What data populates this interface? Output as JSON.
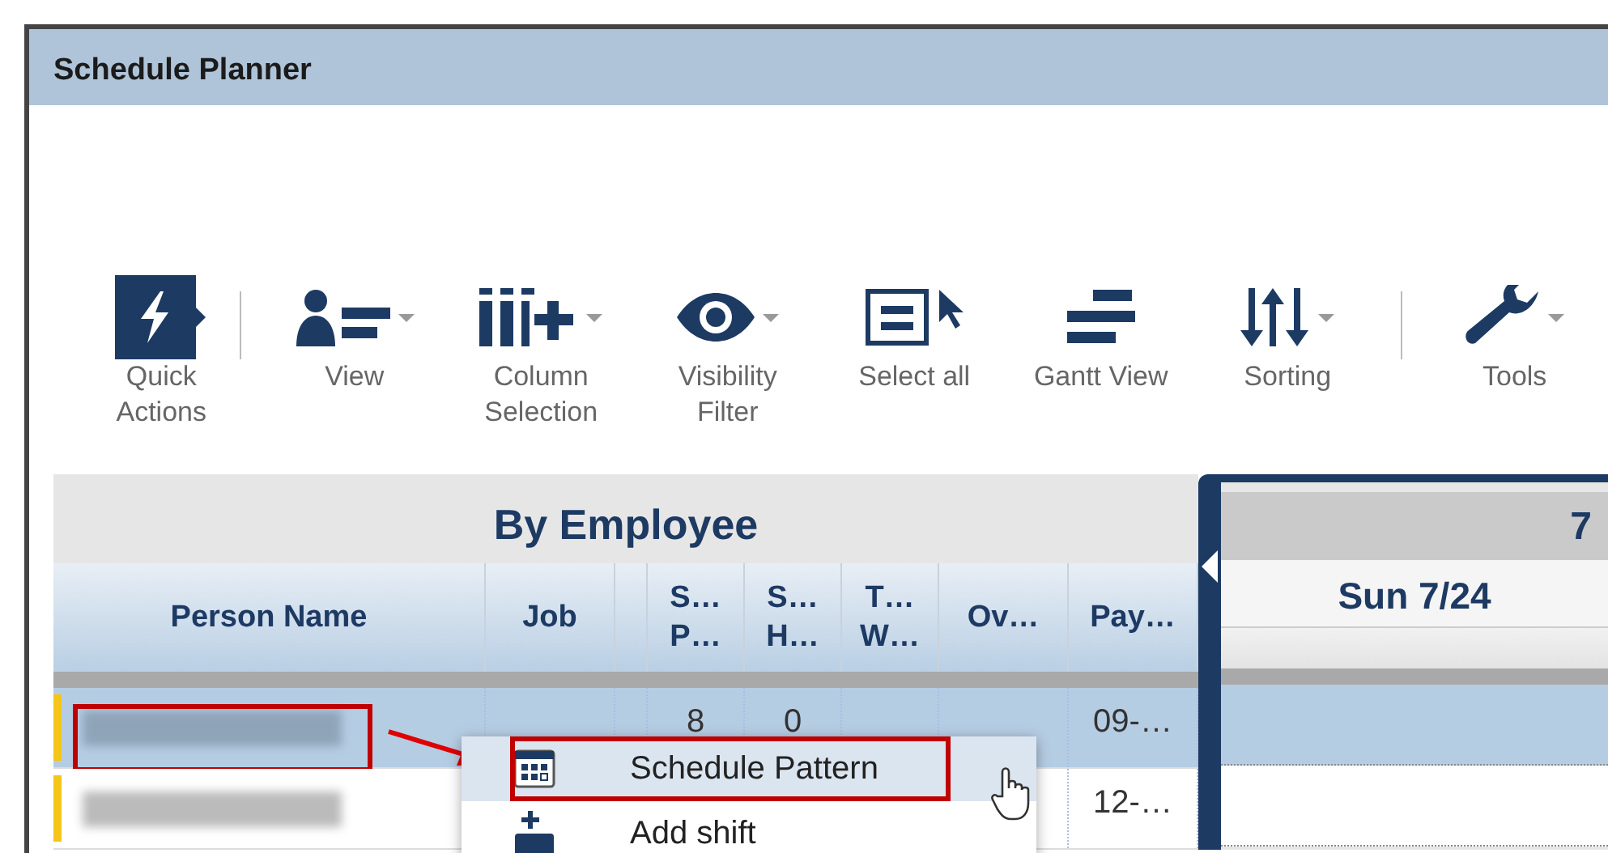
{
  "window": {
    "title": "Schedule Planner"
  },
  "toolbar": [
    {
      "kind": "quick",
      "label": [
        "Quick",
        "Actions"
      ],
      "dropdown": false
    },
    {
      "kind": "separator"
    },
    {
      "kind": "view",
      "label": [
        "View"
      ],
      "dropdown": true
    },
    {
      "kind": "columns",
      "label": [
        "Column",
        "Selection"
      ],
      "dropdown": true
    },
    {
      "kind": "eye",
      "label": [
        "Visibility",
        "Filter"
      ],
      "dropdown": true
    },
    {
      "kind": "select",
      "label": [
        "Select all"
      ],
      "dropdown": false
    },
    {
      "kind": "gantt",
      "label": [
        "Gantt View"
      ],
      "dropdown": false
    },
    {
      "kind": "sorting",
      "label": [
        "Sorting"
      ],
      "dropdown": true
    },
    {
      "kind": "separator"
    },
    {
      "kind": "tools",
      "label": [
        "Tools"
      ],
      "dropdown": true
    }
  ],
  "grid": {
    "title": "By Employee",
    "columns": [
      {
        "label": [
          "Person Name"
        ]
      },
      {
        "label": [
          "Job"
        ]
      },
      {},
      {
        "label": [
          "S…",
          "P…"
        ]
      },
      {
        "label": [
          "S…",
          "H…"
        ]
      },
      {
        "label": [
          "T…",
          "W…"
        ]
      },
      {
        "label": [
          "Ov…"
        ]
      },
      {
        "label": [
          "Pay…"
        ]
      }
    ],
    "rows": [
      {
        "selected": true,
        "color": "#f5c518",
        "outlined": true,
        "cells": [
          "",
          "",
          "",
          "8",
          "0",
          "",
          "",
          "09-…"
        ]
      },
      {
        "selected": false,
        "color": "#f5c518",
        "outlined": false,
        "cells": [
          "",
          "",
          "",
          "",
          "",
          "",
          "",
          "12-…"
        ]
      }
    ]
  },
  "calendar": {
    "week": "7",
    "days": [
      "Sun 7/24"
    ]
  },
  "context_menu": {
    "items": [
      {
        "kind": "pattern",
        "label": "Schedule Pattern",
        "highlighted": true,
        "outlined": true
      },
      {
        "kind": "add",
        "label": "Add shift",
        "highlighted": false,
        "outlined": false
      }
    ]
  }
}
